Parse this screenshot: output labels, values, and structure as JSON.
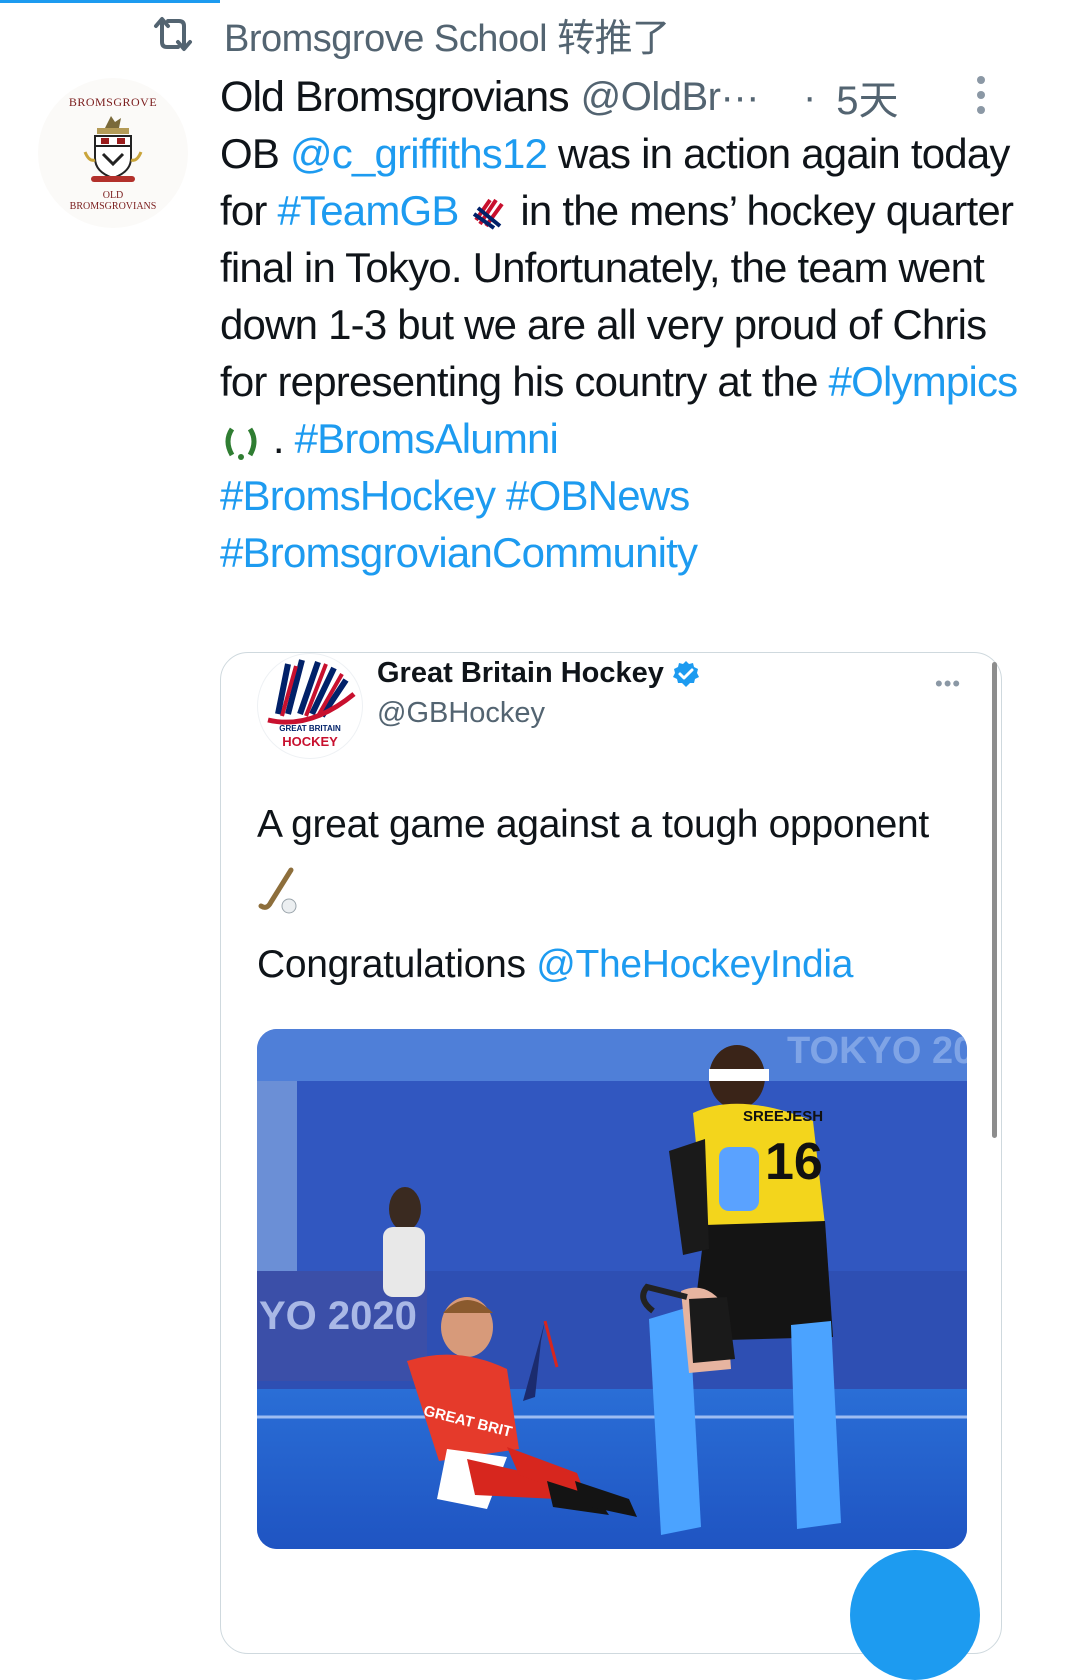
{
  "retweet": {
    "icon": "retweet-icon",
    "text": "Bromsgrove School 转推了"
  },
  "tweet": {
    "avatar": {
      "top_text": "BROMSGROVE",
      "bottom_line1": "OLD",
      "bottom_line2": "BROMSGROVIANS"
    },
    "display_name": "Old Bromsgrovians",
    "handle": "@OldBr···",
    "separator": "·",
    "time": "5天",
    "text": {
      "t1": "OB ",
      "mention": "@c_griffiths12",
      "t2": " was in action again today for ",
      "hashtag_teamgb": "#TeamGB",
      "t3": " in the mens’ hockey quarter final in Tokyo. Unfortunately, the team went down 1-3 but we are all very proud of Chris for representing his country at the ",
      "hashtag_olympics": "#Olympics",
      "t4": " . ",
      "hashtag_bromsalumni": "#BromsAlumni",
      "hashtag_bromshockey": "#BromsHockey",
      "hashtag_obnews": "#OBNews",
      "hashtag_community": "#BromsgrovianCommunity"
    }
  },
  "quote": {
    "name": "Great Britain Hockey",
    "handle": "@GBHockey",
    "more": "•••",
    "avatar_line1": "GREAT BRITAIN",
    "avatar_line2": "HOCKEY",
    "text_line": "A great game against a tough opponent",
    "congrats": "Congratulations ",
    "mention": "@TheHockeyIndia",
    "photo": {
      "banner_top": "TOKYO 20",
      "banner_side": "YO 2020",
      "jersey_name": "SREEJESH",
      "jersey_number": "16",
      "shirt_text": "GREAT BRIT"
    }
  },
  "colors": {
    "link": "#1d9bf0",
    "text": "#0f1419",
    "secondary": "#536471"
  }
}
